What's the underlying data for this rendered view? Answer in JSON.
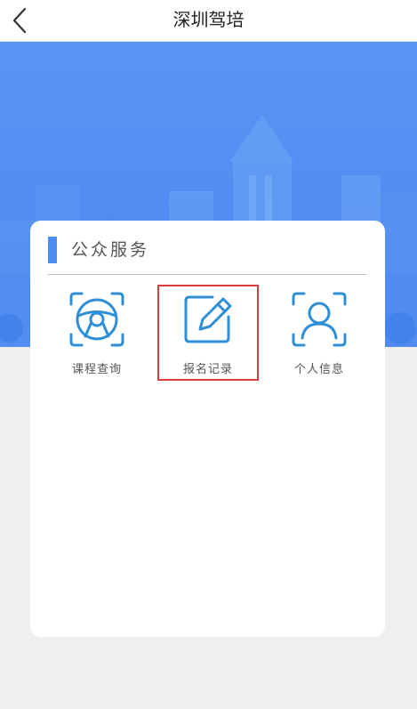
{
  "header": {
    "title": "深圳驾培",
    "back_icon": "chevron-left-icon"
  },
  "banner": {
    "color": "#5a96f3"
  },
  "card": {
    "section_title": "公众服务",
    "accent_color": "#4e8df0",
    "services": [
      {
        "label": "课程查询",
        "icon": "steering-wheel-icon"
      },
      {
        "label": "报名记录",
        "icon": "edit-note-icon",
        "highlight_color": "#e23b3b"
      },
      {
        "label": "个人信息",
        "icon": "user-profile-icon"
      }
    ]
  }
}
